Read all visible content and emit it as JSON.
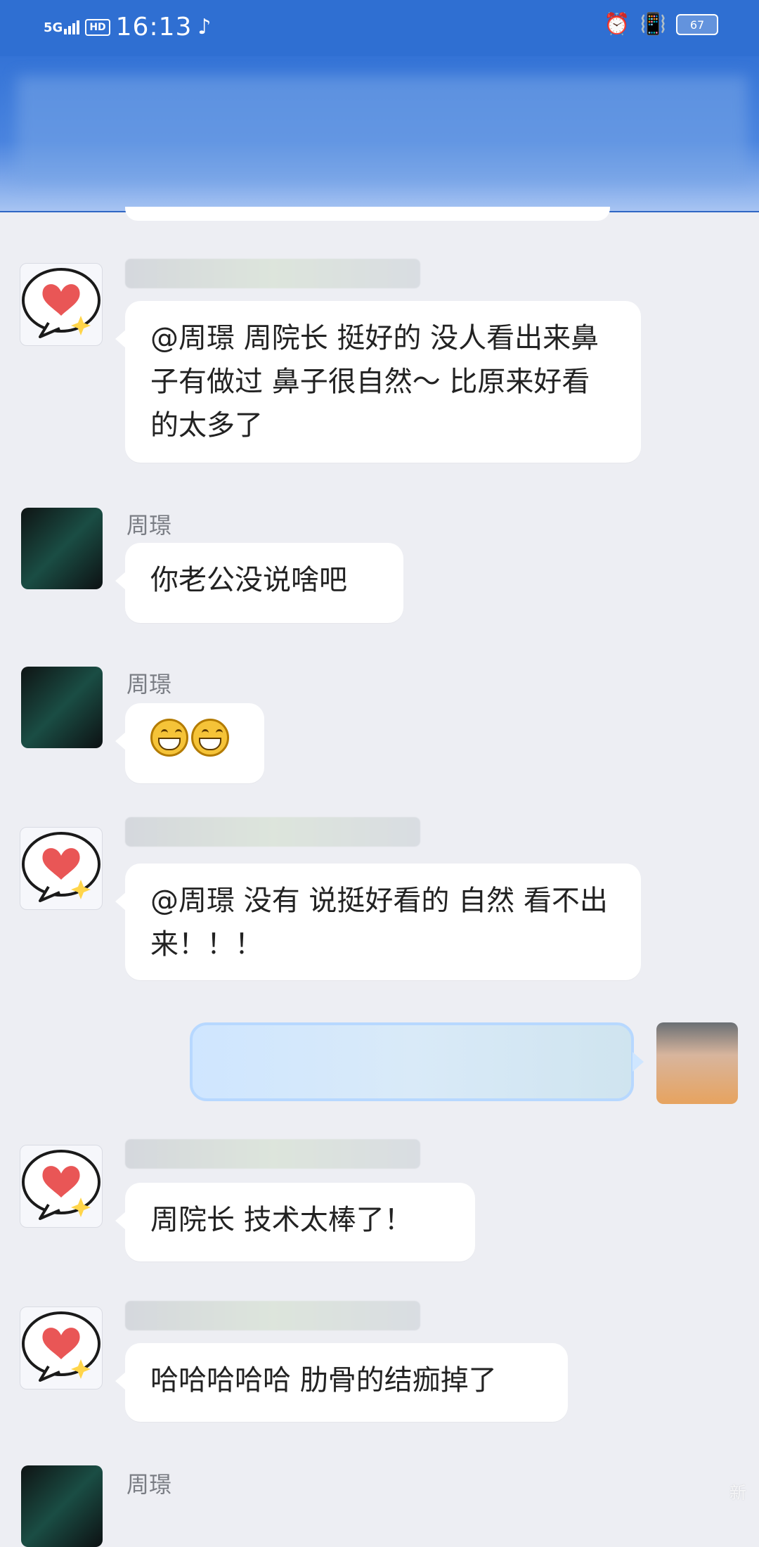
{
  "status": {
    "network": "5G",
    "hd": "HD",
    "time": "16:13",
    "battery": "67"
  },
  "messages": [
    {
      "type": "left",
      "sender": "",
      "text": "@周璟  周院长 挺好的 没人看出来鼻子有做过 鼻子很自然～ 比原来好看的太多了"
    },
    {
      "type": "left",
      "sender": "周璟",
      "text": "你老公没说啥吧"
    },
    {
      "type": "left",
      "sender": "周璟",
      "text": ""
    },
    {
      "type": "left",
      "sender": "",
      "text": "@周璟  没有 说挺好看的 自然 看不出来！！！"
    },
    {
      "type": "right",
      "sender": "",
      "text": ""
    },
    {
      "type": "left",
      "sender": "",
      "text": "周院长 技术太棒了！"
    },
    {
      "type": "left",
      "sender": "",
      "text": "哈哈哈哈哈 肋骨的结痂掉了"
    },
    {
      "type": "left",
      "sender": "周璟",
      "text": ""
    }
  ],
  "icons": {
    "signal": "signal-icon",
    "tiktok": "tiktok-icon",
    "alarm": "alarm-icon",
    "vibrate": "vibrate-icon",
    "battery": "battery-icon",
    "heart": "heart-icon",
    "grinning": "grinning-emoji-icon"
  },
  "watermark": "新"
}
